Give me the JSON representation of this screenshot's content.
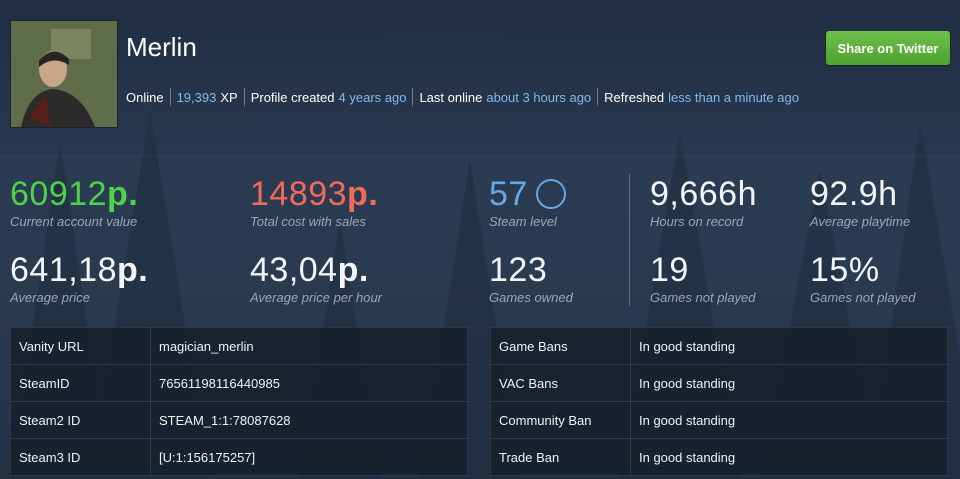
{
  "profile": {
    "name": "Merlin",
    "status": "Online",
    "xp_value": "19,393",
    "xp_unit": "XP",
    "created_label": "Profile created",
    "created_value": "4 years ago",
    "last_online_label": "Last online",
    "last_online_value": "about 3 hours ago",
    "refreshed_label": "Refreshed",
    "refreshed_value": "less than a minute ago"
  },
  "share_button": "Share on Twitter",
  "stats": {
    "account_value": {
      "value": "60912",
      "unit": "p.",
      "label": "Current account value"
    },
    "total_cost": {
      "value": "14893",
      "unit": "p.",
      "label": "Total cost with sales"
    },
    "steam_level": {
      "value": "57",
      "label": "Steam level"
    },
    "hours": {
      "value": "9,666h",
      "label": "Hours on record"
    },
    "avg_playtime": {
      "value": "92.9h",
      "label": "Average playtime"
    },
    "avg_price": {
      "value": "641,18",
      "unit": "p.",
      "label": "Average price"
    },
    "avg_price_hour": {
      "value": "43,04",
      "unit": "p.",
      "label": "Average price per hour"
    },
    "games_owned": {
      "value": "123",
      "label": "Games owned"
    },
    "not_played": {
      "value": "19",
      "label": "Games not played"
    },
    "not_played_pct": {
      "value": "15%",
      "label": "Games not played"
    }
  },
  "ids_table": [
    {
      "key": "Vanity URL",
      "value": "magician_merlin"
    },
    {
      "key": "SteamID",
      "value": "76561198116440985"
    },
    {
      "key": "Steam2 ID",
      "value": "STEAM_1:1:78087628"
    },
    {
      "key": "Steam3 ID",
      "value": "[U:1:156175257]"
    }
  ],
  "bans_table": [
    {
      "key": "Game Bans",
      "value": "In good standing"
    },
    {
      "key": "VAC Bans",
      "value": "In good standing"
    },
    {
      "key": "Community Ban",
      "value": "In good standing"
    },
    {
      "key": "Trade Ban",
      "value": "In good standing"
    }
  ],
  "colors": {
    "green": "#4fd14a",
    "red": "#ef6a5a",
    "blue": "#66a8e6",
    "button": "#5cb13b"
  }
}
